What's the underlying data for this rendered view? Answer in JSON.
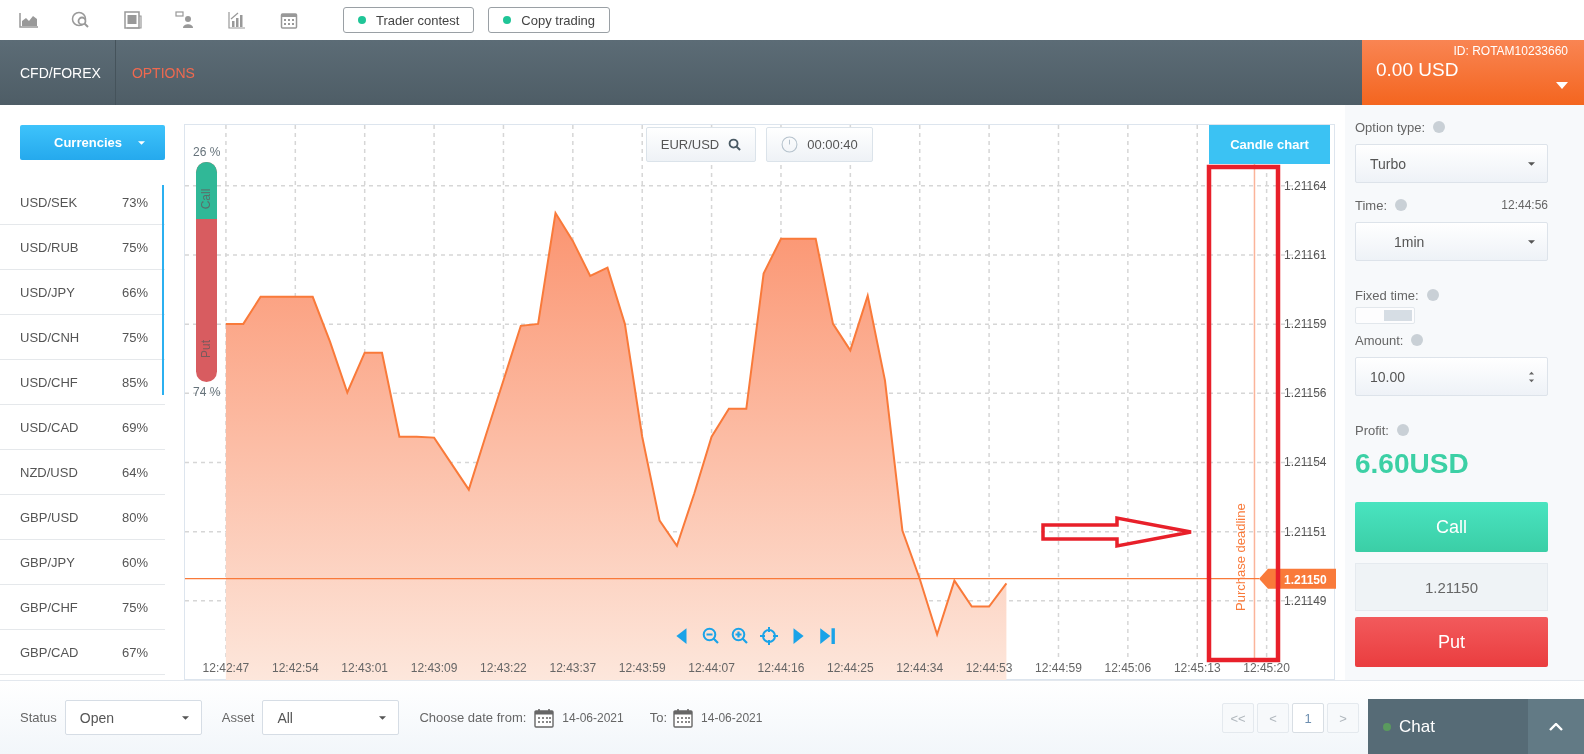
{
  "toolbar": {
    "buttons": [
      {
        "label": "Trader contest"
      },
      {
        "label": "Copy trading"
      }
    ]
  },
  "nav": {
    "tabs": [
      {
        "label": "CFD/FOREX",
        "selected": false
      },
      {
        "label": "OPTIONS",
        "selected": true
      }
    ]
  },
  "account": {
    "id": "ID: ROTAM10233660",
    "balance": "0.00 USD"
  },
  "sidebar": {
    "dropdown": "Currencies",
    "items": [
      {
        "name": "USD/SEK",
        "payout": "73%"
      },
      {
        "name": "USD/RUB",
        "payout": "75%"
      },
      {
        "name": "USD/JPY",
        "payout": "66%"
      },
      {
        "name": "USD/CNH",
        "payout": "75%"
      },
      {
        "name": "USD/CHF",
        "payout": "85%"
      },
      {
        "name": "USD/CAD",
        "payout": "69%"
      },
      {
        "name": "NZD/USD",
        "payout": "64%"
      },
      {
        "name": "GBP/USD",
        "payout": "80%"
      },
      {
        "name": "GBP/JPY",
        "payout": "60%"
      },
      {
        "name": "GBP/CHF",
        "payout": "75%"
      },
      {
        "name": "GBP/CAD",
        "payout": "67%"
      }
    ]
  },
  "chart": {
    "symbol": "EUR/USD",
    "timer": "00:00:40",
    "view_button": "Candle chart",
    "sentiment": {
      "call_label": "Call",
      "put_label": "Put",
      "call_percent": "26 %",
      "put_percent": "74 %",
      "level": 0.26
    },
    "deadline_label": "Purchase deadline",
    "chart_data": {
      "type": "area",
      "grid": true,
      "ylim": [
        1.211461,
        1.211662
      ],
      "categories": [
        null,
        null,
        "12:42:47",
        null,
        null,
        null,
        "12:42:54",
        null,
        null,
        null,
        "12:43:01",
        null,
        null,
        null,
        "12:43:09",
        null,
        null,
        null,
        "12:43:22",
        null,
        null,
        null,
        "12:43:37",
        null,
        null,
        null,
        "12:43:59",
        null,
        null,
        null,
        "12:44:07",
        null,
        null,
        null,
        "12:44:16",
        null,
        null,
        null,
        "12:44:25",
        null,
        null,
        null,
        "12:44:34",
        null,
        null,
        null,
        "12:44:53",
        null,
        null,
        null,
        "12:44:59",
        null,
        null,
        null,
        "12:45:06",
        null,
        null,
        null,
        "12:45:13",
        null,
        null,
        null,
        "12:45:20",
        null,
        null
      ],
      "series": [
        {
          "color": "#f97a3a",
          "values": [
            null,
            null,
            1.2115901,
            1.2115901,
            1.2115999,
            1.2115999,
            1.2115999,
            1.2115999,
            1.2115837,
            1.2115653,
            1.2115797,
            1.2115797,
            1.2115493,
            1.2115493,
            1.211549,
            1.2115396,
            1.2115302,
            1.2115501,
            1.2115697,
            1.2115894,
            1.2115901,
            1.2116302,
            1.2116201,
            1.2116074,
            1.2116104,
            1.2115901,
            1.2115493,
            1.211519,
            1.2115099,
            1.2115287,
            1.2115493,
            1.2115594,
            1.2115594,
            1.2116083,
            1.2116209,
            1.2116209,
            1.2116209,
            1.2115901,
            1.2115805,
            1.2116003,
            1.2115696,
            1.2115154,
            1.211498,
            1.2114778,
            1.2114973,
            1.2114879,
            1.2114879,
            1.2114963,
            null,
            null,
            null,
            null,
            null,
            null,
            null,
            null,
            null,
            null,
            null,
            null,
            null,
            null,
            null,
            null,
            null
          ]
        }
      ],
      "yticks": [
        {
          "value": 1.21164,
          "label": "1.21164"
        },
        {
          "value": 1.211615,
          "label": "1.21161"
        },
        {
          "value": 1.21159,
          "label": "1.21159"
        },
        {
          "value": 1.211565,
          "label": "1.21156"
        },
        {
          "value": 1.21154,
          "label": "1.21154"
        },
        {
          "value": 1.211515,
          "label": "1.21151"
        },
        {
          "value": 1.21149,
          "label": "1.21149"
        }
      ],
      "ref_lines": [
        {
          "axis": "y",
          "value": 1.211498,
          "label": "1.21150"
        }
      ]
    }
  },
  "trade_panel": {
    "option_type": {
      "label": "Option type:",
      "value": "Turbo"
    },
    "time": {
      "label": "Time:",
      "clock": "12:44:56",
      "value": "1min"
    },
    "fixed_time": {
      "label": "Fixed time:",
      "on": false
    },
    "amount": {
      "label": "Amount:",
      "value": "10.00"
    },
    "profit": {
      "label": "Profit:",
      "value": "6.60USD"
    },
    "call_button": "Call",
    "strike": "1.21150",
    "put_button": "Put"
  },
  "filters": {
    "selects": [
      {
        "label": "Status",
        "value": "Open"
      },
      {
        "label": "Asset",
        "value": "All"
      }
    ],
    "date_from_label": "Choose date from:",
    "date_from": "14-06-2021",
    "date_to_label": "To:",
    "date_to": "14-06-2021"
  },
  "pagination": [
    {
      "label": "<<",
      "selected": false
    },
    {
      "label": "<",
      "selected": false
    },
    {
      "label": "1",
      "selected": true
    },
    {
      "label": ">",
      "selected": false
    }
  ],
  "chat": {
    "label": "Chat",
    "online": true
  }
}
